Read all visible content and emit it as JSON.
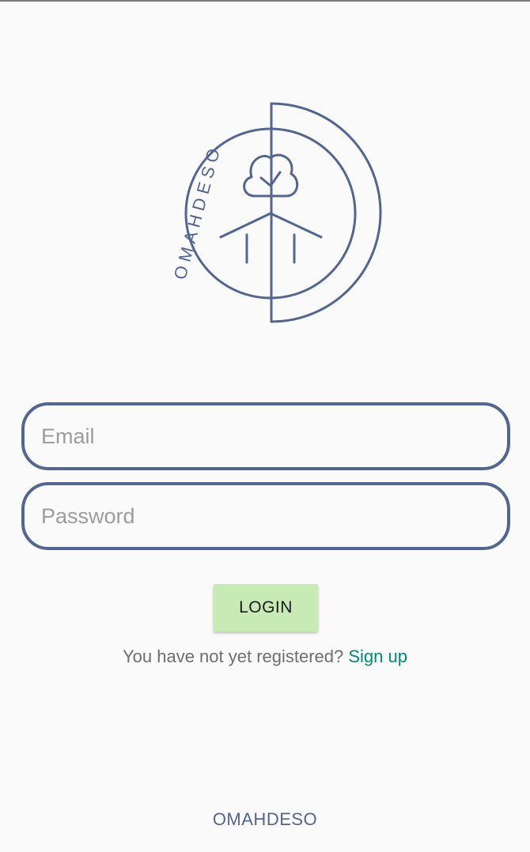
{
  "brand": {
    "logo_text": "OMAHDESO",
    "footer_text": "OMAHDESO",
    "color": "#536591"
  },
  "form": {
    "email_placeholder": "Email",
    "password_placeholder": "Password",
    "login_label": "LOGIN",
    "login_color": "#c8ebb6"
  },
  "register": {
    "prompt": "You have not yet registered?",
    "link_label": "Sign up",
    "link_color": "#00897b"
  }
}
